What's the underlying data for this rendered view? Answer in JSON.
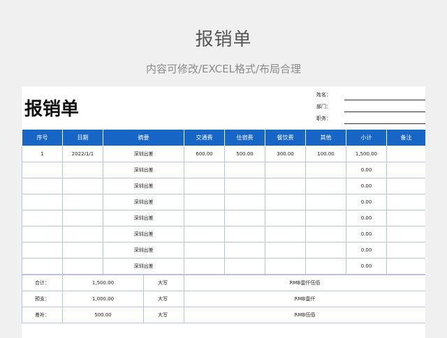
{
  "header": {
    "title": "报销单",
    "subtitle": "内容可修改/EXCEL格式/布局合理"
  },
  "form": {
    "title": "报销单",
    "meta": [
      {
        "label": "姓名："
      },
      {
        "label": "部门："
      },
      {
        "label": "职务："
      }
    ],
    "columns": [
      "序号",
      "日期",
      "摘要",
      "交通费",
      "住宿费",
      "餐饮费",
      "其他",
      "小计",
      "备注"
    ],
    "rows": [
      {
        "no": "1",
        "date": "2022/1/1",
        "summary": "深圳出差",
        "transport": "600.00",
        "lodging": "500.00",
        "meals": "300.00",
        "other": "100.00",
        "subtotal": "1,500.00",
        "remark": ""
      },
      {
        "no": "",
        "date": "",
        "summary": "深圳出差",
        "transport": "",
        "lodging": "",
        "meals": "",
        "other": "",
        "subtotal": "0.00",
        "remark": ""
      },
      {
        "no": "",
        "date": "",
        "summary": "深圳出差",
        "transport": "",
        "lodging": "",
        "meals": "",
        "other": "",
        "subtotal": "0.00",
        "remark": ""
      },
      {
        "no": "",
        "date": "",
        "summary": "深圳出差",
        "transport": "",
        "lodging": "",
        "meals": "",
        "other": "",
        "subtotal": "0.00",
        "remark": ""
      },
      {
        "no": "",
        "date": "",
        "summary": "深圳出差",
        "transport": "",
        "lodging": "",
        "meals": "",
        "other": "",
        "subtotal": "0.00",
        "remark": ""
      },
      {
        "no": "",
        "date": "",
        "summary": "深圳出差",
        "transport": "",
        "lodging": "",
        "meals": "",
        "other": "",
        "subtotal": "0.00",
        "remark": ""
      },
      {
        "no": "",
        "date": "",
        "summary": "深圳出差",
        "transport": "",
        "lodging": "",
        "meals": "",
        "other": "",
        "subtotal": "0.00",
        "remark": ""
      },
      {
        "no": "",
        "date": "",
        "summary": "深圳出差",
        "transport": "",
        "lodging": "",
        "meals": "",
        "other": "",
        "subtotal": "0.00",
        "remark": ""
      }
    ],
    "summary": [
      {
        "label": "合计：",
        "amount": "1,500.00",
        "cap_label": "大写",
        "cap_value": "RMB壹仟伍佰"
      },
      {
        "label": "预支：",
        "amount": "1,000.00",
        "cap_label": "大写",
        "cap_value": "RMB壹仟"
      },
      {
        "label": "差补：",
        "amount": "500.00",
        "cap_label": "大写",
        "cap_value": "RMB伍佰"
      }
    ]
  },
  "colors": {
    "header_blue": "#1766c5",
    "background": "#f0f0f0",
    "grid": "#b9c4d6"
  }
}
